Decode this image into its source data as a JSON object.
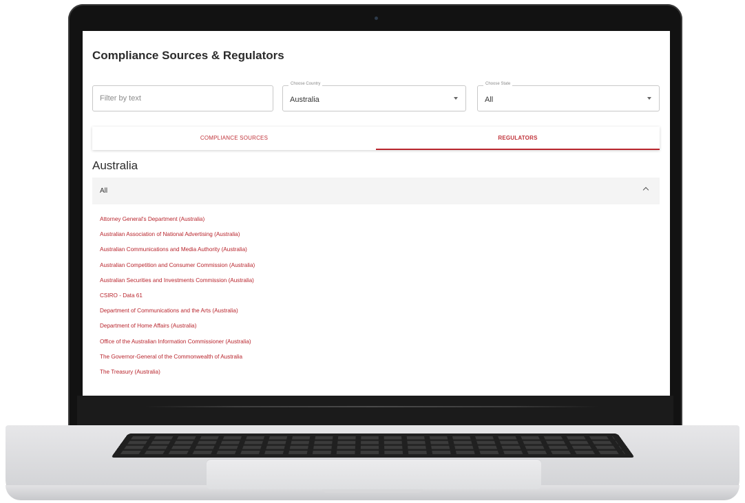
{
  "app": {
    "title": "Compliance Sources & Regulators"
  },
  "filters": {
    "text_placeholder": "Filter by text",
    "country": {
      "legend": "Choose Country",
      "value": "Australia"
    },
    "state": {
      "legend": "Choose State",
      "value": "All"
    }
  },
  "tabs": [
    {
      "label": "COMPLIANCE SOURCES",
      "active": false
    },
    {
      "label": "REGULATORS",
      "active": true
    }
  ],
  "section": {
    "heading": "Australia",
    "accordion_label": "All",
    "regulators": [
      "Attorney General's Department (Australia)",
      "Australian Association of National Advertising (Australia)",
      "Australian Communications and Media Authority (Australia)",
      "Australian Competition and Consumer Commission (Australia)",
      "Australian Securities and Investments Commission (Australia)",
      "CSIRO - Data 61",
      "Department of Communications and the Arts (Australia)",
      "Department of Home Affairs (Australia)",
      "Office of the Australian Information Commissioner (Australia)",
      "The Governor-General of the Commonwealth of Australia",
      "The Treasury (Australia)"
    ]
  },
  "colors": {
    "accent": "#b8242c",
    "tab_text": "#c0333a"
  },
  "icons": {
    "dropdown": "caret-down-icon",
    "accordion": "chevron-up-icon"
  }
}
